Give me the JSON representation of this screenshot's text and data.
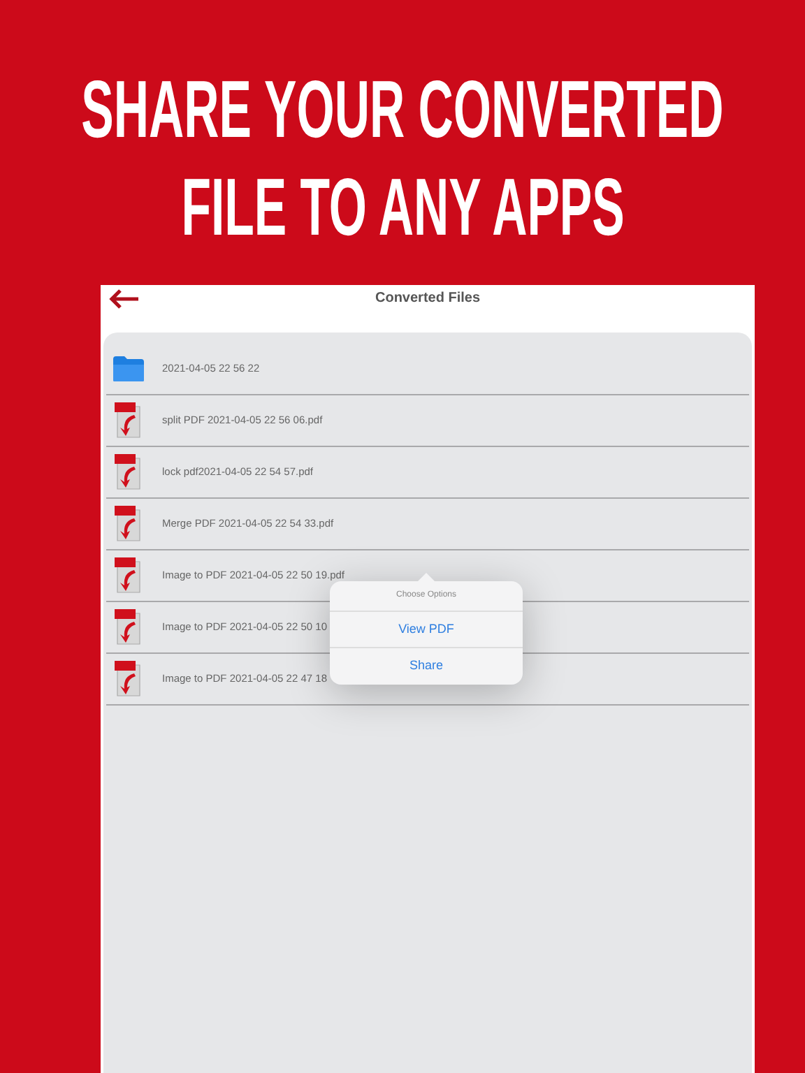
{
  "headline_lines": [
    "SHARE YOUR CONVERTED",
    "FILE TO ANY APPS"
  ],
  "screen": {
    "title": "Converted Files"
  },
  "files": [
    {
      "kind": "folder",
      "name": "2021-04-05 22 56 22"
    },
    {
      "kind": "pdf",
      "name": "split PDF 2021-04-05 22 56 06.pdf"
    },
    {
      "kind": "pdf",
      "name": "lock pdf2021-04-05 22 54 57.pdf"
    },
    {
      "kind": "pdf",
      "name": "Merge PDF 2021-04-05 22 54 33.pdf"
    },
    {
      "kind": "pdf",
      "name": "Image to PDF 2021-04-05 22 50 19.pdf"
    },
    {
      "kind": "pdf",
      "name": "Image to PDF 2021-04-05 22 50 10"
    },
    {
      "kind": "pdf",
      "name": "Image to PDF 2021-04-05 22 47 18"
    }
  ],
  "popover": {
    "title": "Choose Options",
    "options": [
      "View PDF",
      "Share"
    ]
  }
}
